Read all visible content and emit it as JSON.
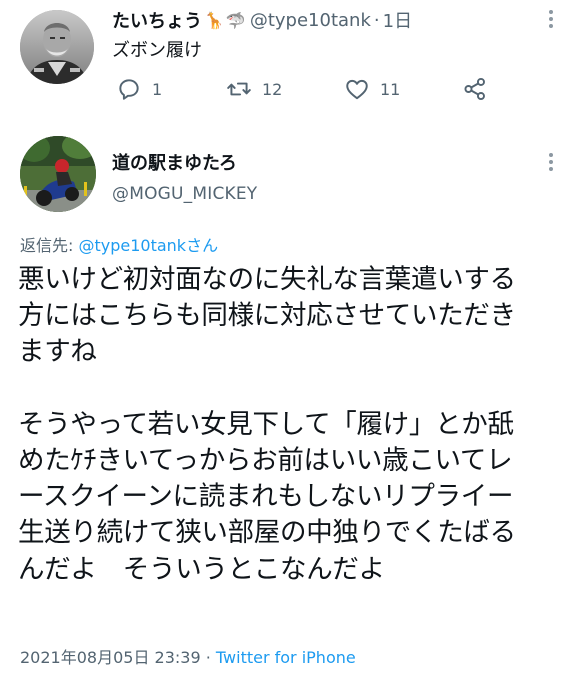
{
  "parent_tweet": {
    "display_name": "たいちょう",
    "emojis": [
      "🦒",
      "🦈"
    ],
    "handle": "@type10tank",
    "separator": "·",
    "time": "1日",
    "text": "ズボン履け",
    "replies": "1",
    "retweets": "12",
    "likes": "11",
    "icons": [
      "reply-icon",
      "retweet-icon",
      "like-icon",
      "share-icon",
      "more-icon"
    ]
  },
  "main_tweet": {
    "display_name": "道の駅まゆたろ",
    "handle": "@MOGU_MICKEY",
    "replying_label": "返信先: ",
    "replying_handle": "@type10tankさん",
    "text_lines": [
      "悪いけど初対面なのに失礼な言葉遣いする",
      "方にはこちらも同様に対応させていただき",
      "ますね",
      "",
      "そうやって若い女見下して「履け」とか舐",
      "めたｹﾁきいてっからお前はいい歳こいてレ",
      "ースクイーンに読まれもしないリプライー",
      "生送り続けて狭い部屋の中独りでくたばる",
      "んだよ　そういうとこなんだよ"
    ],
    "timestamp": "2021年08月05日 23:39",
    "meta_separator": " · ",
    "source": "Twitter for iPhone"
  },
  "colors": {
    "text": "#0f1419",
    "secondary": "#536471",
    "link": "#1d9bf0"
  }
}
